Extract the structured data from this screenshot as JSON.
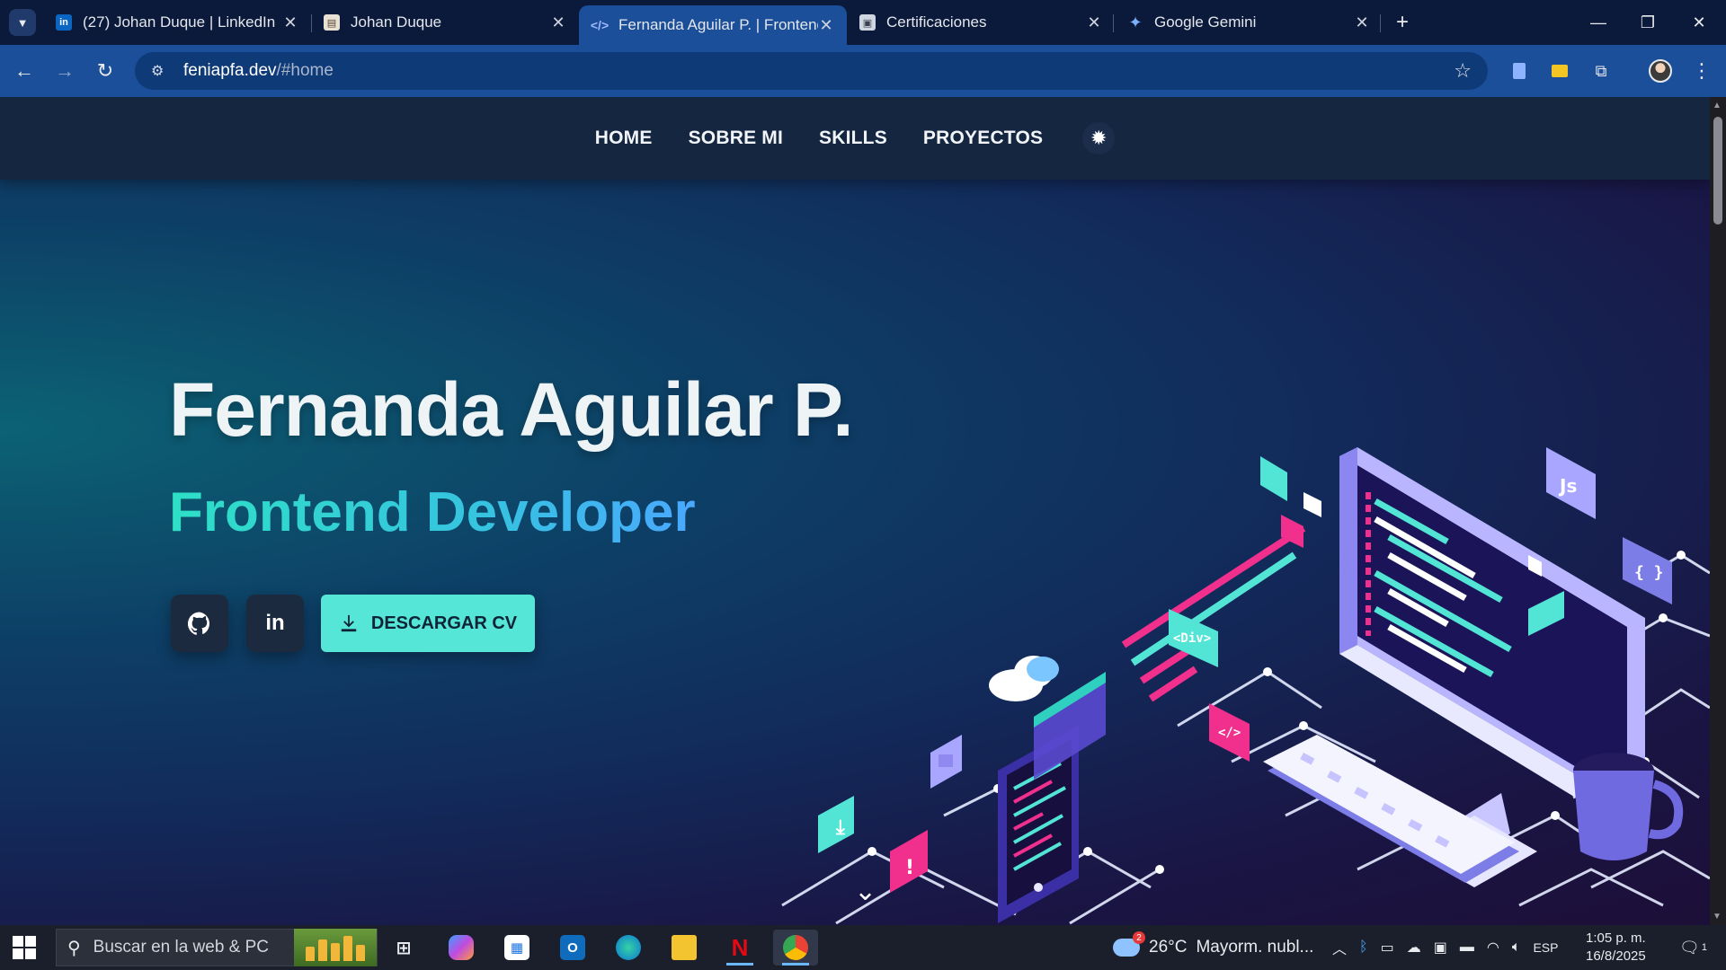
{
  "browser": {
    "tabs": [
      {
        "title": "(27) Johan Duque | LinkedIn",
        "favicon": "linkedin-icon",
        "active": false
      },
      {
        "title": "Johan Duque",
        "favicon": "document-icon",
        "active": false
      },
      {
        "title": "Fernanda Aguilar P. | Frontend D",
        "favicon": "code-icon",
        "active": true
      },
      {
        "title": "Certificaciones",
        "favicon": "folder-icon",
        "active": false
      },
      {
        "title": "Google Gemini",
        "favicon": "gemini-icon",
        "active": false
      }
    ],
    "address": {
      "host": "feniapfa.dev",
      "path": "/#home"
    }
  },
  "site": {
    "nav": [
      "HOME",
      "SOBRE MI",
      "SKILLS",
      "PROYECTOS"
    ],
    "hero": {
      "name": "Fernanda Aguilar P.",
      "role": "Frontend Developer",
      "cv_label": "DESCARGAR CV"
    },
    "illustration_labels": {
      "js": "Js",
      "braces": "{ }",
      "div": "<Div>",
      "tag": "</>",
      "alert": "!"
    },
    "colors": {
      "accent": "#55e6d8",
      "nav_bg": "#152640",
      "pink": "#f0308c",
      "violet": "#7d7de8"
    }
  },
  "taskbar": {
    "search_placeholder": "Buscar en la web & PC",
    "weather": {
      "temp": "26°C",
      "desc": "Mayorm. nubl...",
      "badge": "2"
    },
    "language": "ESP",
    "time": "1:05 p. m.",
    "date": "16/8/2025",
    "notifications": "1"
  }
}
